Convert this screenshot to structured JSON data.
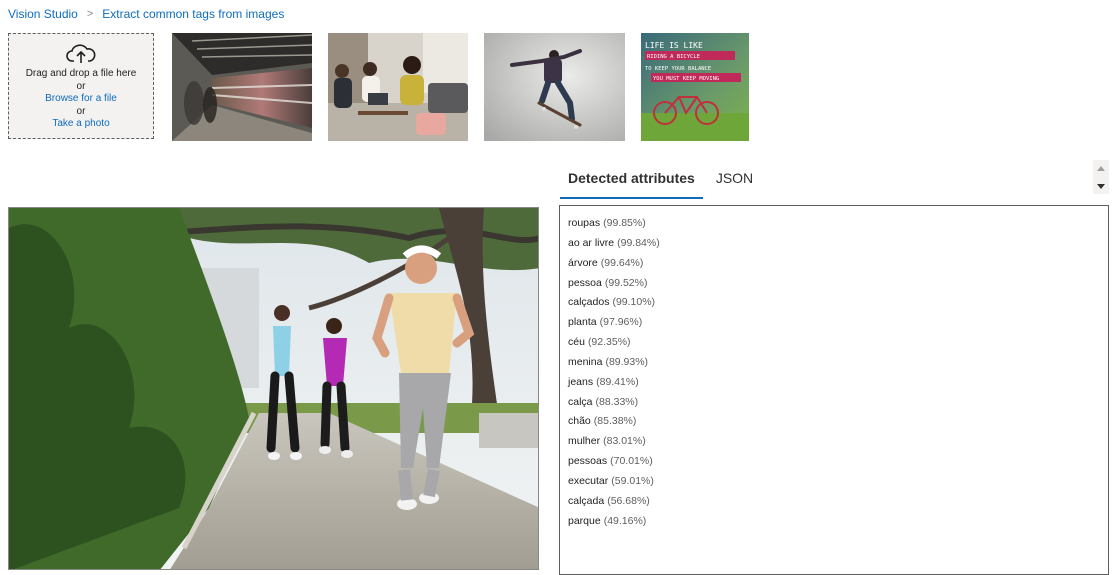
{
  "breadcrumb": {
    "home": "Vision Studio",
    "current": "Extract common tags from images"
  },
  "dropzone": {
    "line1": "Drag and drop a file here",
    "or1": "or",
    "browse": "Browse for a file",
    "or2": "or",
    "photo": "Take a photo"
  },
  "poster": {
    "line1": "LIFE IS LIKE",
    "line2": "RIDING A BICYCLE",
    "line3": "TO KEEP YOUR BALANCE",
    "line4": "YOU MUST KEEP MOVING"
  },
  "tabs": [
    {
      "label": "Detected attributes",
      "active": true
    },
    {
      "label": "JSON",
      "active": false
    }
  ],
  "tags": [
    {
      "name": "roupas",
      "confidence": "(99.85%)"
    },
    {
      "name": "ao ar livre",
      "confidence": "(99.84%)"
    },
    {
      "name": "árvore",
      "confidence": "(99.64%)"
    },
    {
      "name": "pessoa",
      "confidence": "(99.52%)"
    },
    {
      "name": "calçados",
      "confidence": "(99.10%)"
    },
    {
      "name": "planta",
      "confidence": "(97.96%)"
    },
    {
      "name": "céu",
      "confidence": "(92.35%)"
    },
    {
      "name": "menina",
      "confidence": "(89.93%)"
    },
    {
      "name": "jeans",
      "confidence": "(89.41%)"
    },
    {
      "name": "calça",
      "confidence": "(88.33%)"
    },
    {
      "name": "chão",
      "confidence": "(85.38%)"
    },
    {
      "name": "mulher",
      "confidence": "(83.01%)"
    },
    {
      "name": "pessoas",
      "confidence": "(70.01%)"
    },
    {
      "name": "executar",
      "confidence": "(59.01%)"
    },
    {
      "name": "calçada",
      "confidence": "(56.68%)"
    },
    {
      "name": "parque",
      "confidence": "(49.16%)"
    }
  ],
  "colors": {
    "accent": "#0f6cbd",
    "dropzone_bg": "#f3f2f1"
  }
}
